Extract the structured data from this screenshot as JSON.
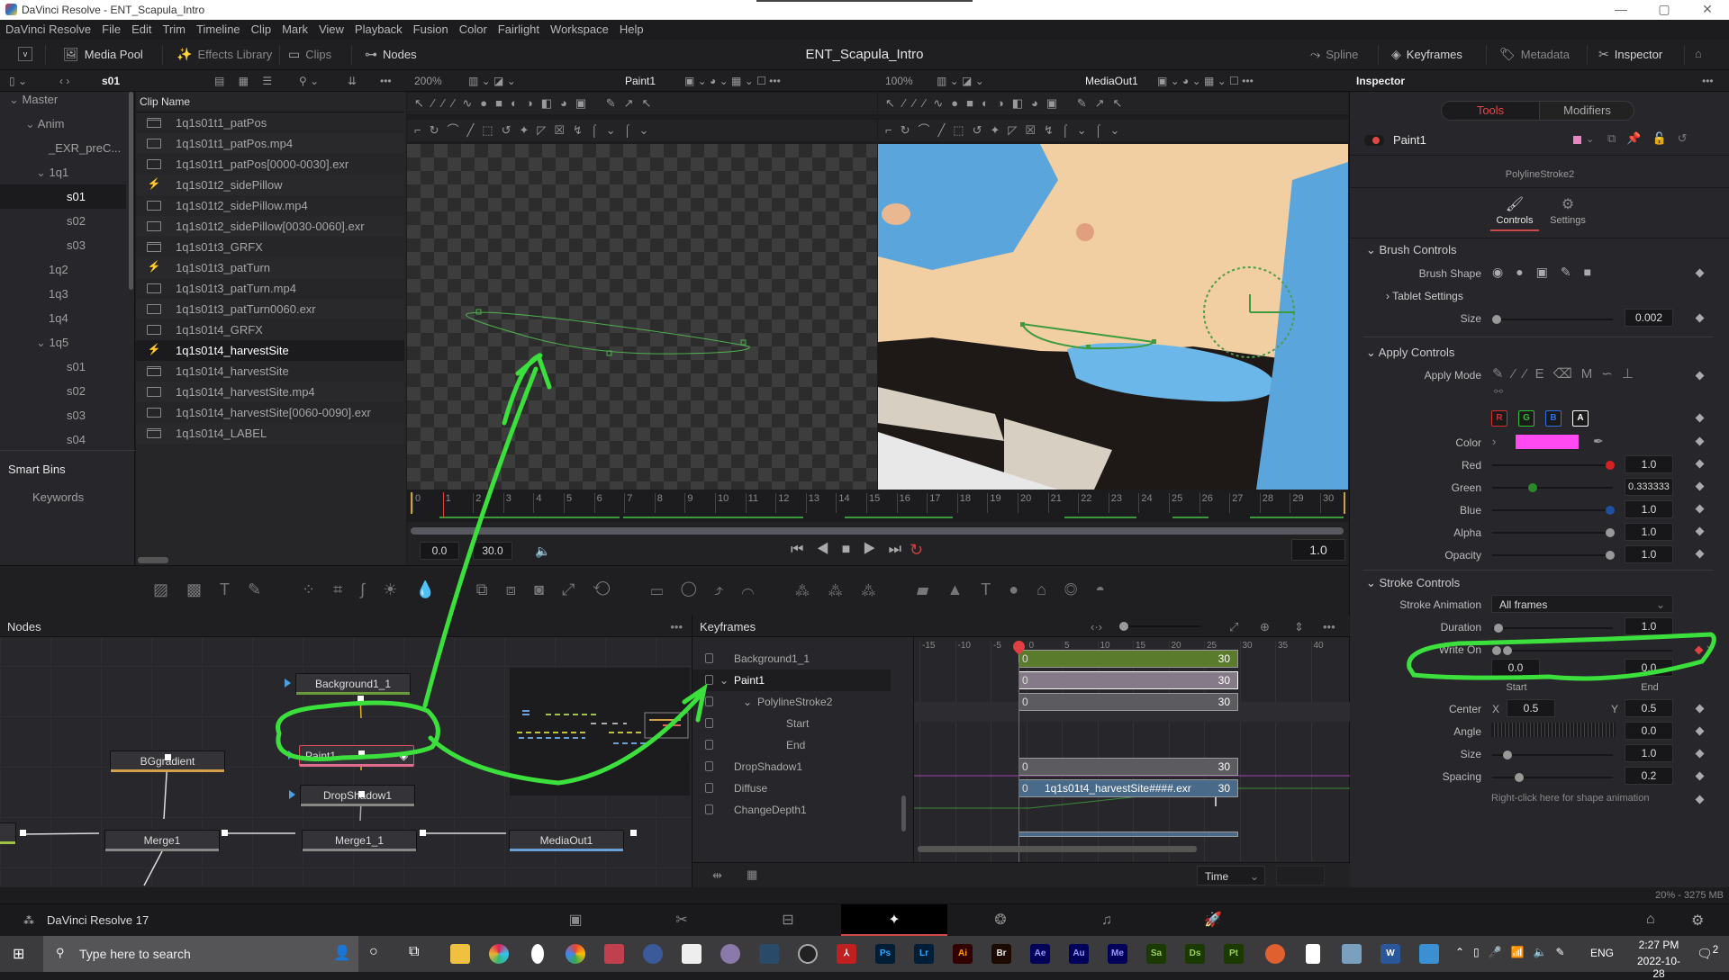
{
  "window": {
    "title": "DaVinci Resolve - ENT_Scapula_Intro",
    "controls": [
      "—",
      "▢",
      "✕"
    ]
  },
  "menu": [
    "DaVinci Resolve",
    "File",
    "Edit",
    "Trim",
    "Timeline",
    "Clip",
    "Mark",
    "View",
    "Playback",
    "Fusion",
    "Color",
    "Fairlight",
    "Workspace",
    "Help"
  ],
  "toolbar": {
    "media_pool": "Media Pool",
    "effects_library": "Effects Library",
    "clips": "Clips",
    "nodes": "Nodes",
    "project_title": "ENT_Scapula_Intro",
    "spline": "Spline",
    "keyframes": "Keyframes",
    "metadata": "Metadata",
    "inspector": "Inspector"
  },
  "subbar": {
    "current_bin": "s01",
    "viewer1_zoom": "200%",
    "viewer1_name": "Paint1",
    "viewer2_zoom": "100%",
    "viewer2_name": "MediaOut1",
    "inspector_title": "Inspector"
  },
  "bins": {
    "items": [
      {
        "label": "Master",
        "indent": 0,
        "expanded": true
      },
      {
        "label": "Anim",
        "indent": 1,
        "expanded": true
      },
      {
        "label": "_EXR_preC...",
        "indent": 2
      },
      {
        "label": "1q1",
        "indent": 2,
        "expanded": true
      },
      {
        "label": "s01",
        "indent": 3,
        "selected": true
      },
      {
        "label": "s02",
        "indent": 3
      },
      {
        "label": "s03",
        "indent": 3
      },
      {
        "label": "1q2",
        "indent": 2
      },
      {
        "label": "1q3",
        "indent": 2
      },
      {
        "label": "1q4",
        "indent": 2
      },
      {
        "label": "1q5",
        "indent": 2,
        "expanded": true
      },
      {
        "label": "s01",
        "indent": 3
      },
      {
        "label": "s02",
        "indent": 3
      },
      {
        "label": "s03",
        "indent": 3
      },
      {
        "label": "s04",
        "indent": 3
      }
    ],
    "smart_bins": "Smart Bins",
    "keywords": "Keywords"
  },
  "clips": {
    "header": "Clip Name",
    "items": [
      {
        "name": "1q1s01t1_patPos",
        "icon": "timeline"
      },
      {
        "name": "1q1s01t1_patPos.mp4",
        "icon": "video"
      },
      {
        "name": "1q1s01t1_patPos[0000-0030].exr",
        "icon": "video"
      },
      {
        "name": "1q1s01t2_sidePillow",
        "icon": "fusion"
      },
      {
        "name": "1q1s01t2_sidePillow.mp4",
        "icon": "video"
      },
      {
        "name": "1q1s01t2_sidePillow[0030-0060].exr",
        "icon": "video"
      },
      {
        "name": "1q1s01t3_GRFX",
        "icon": "timeline"
      },
      {
        "name": "1q1s01t3_patTurn",
        "icon": "fusion"
      },
      {
        "name": "1q1s01t3_patTurn.mp4",
        "icon": "video"
      },
      {
        "name": "1q1s01t3_patTurn0060.exr",
        "icon": "video"
      },
      {
        "name": "1q1s01t4_GRFX",
        "icon": "video"
      },
      {
        "name": "1q1s01t4_harvestSite",
        "icon": "fusion",
        "selected": true
      },
      {
        "name": "1q1s01t4_harvestSite",
        "icon": "timeline"
      },
      {
        "name": "1q1s01t4_harvestSite.mp4",
        "icon": "video"
      },
      {
        "name": "1q1s01t4_harvestSite[0060-0090].exr",
        "icon": "video"
      },
      {
        "name": "1q1s01t4_LABEL",
        "icon": "timeline"
      }
    ]
  },
  "ruler": {
    "ticks": [
      "0",
      "1",
      "2",
      "3",
      "4",
      "5",
      "6",
      "7",
      "8",
      "9",
      "10",
      "11",
      "12",
      "13",
      "14",
      "15",
      "16",
      "17",
      "18",
      "19",
      "20",
      "21",
      "22",
      "23",
      "24",
      "25",
      "26",
      "27",
      "28",
      "29",
      "30"
    ]
  },
  "transport": {
    "start": "0.0",
    "end": "30.0",
    "current": "1.0"
  },
  "inspector": {
    "tabs": [
      "Tools",
      "Modifiers"
    ],
    "active_tab": "Tools",
    "node_name": "Paint1",
    "tool_color": "#e884c0",
    "stroke_name": "PolylineStroke2",
    "subtabs": [
      "Controls",
      "Settings"
    ],
    "brush_controls": {
      "title": "Brush Controls",
      "brush_shape": "Brush Shape",
      "tablet_settings": "Tablet Settings",
      "size_label": "Size",
      "size": "0.002"
    },
    "apply_controls": {
      "title": "Apply Controls",
      "apply_mode": "Apply Mode",
      "channels": [
        "R",
        "G",
        "B",
        "A"
      ],
      "color_label": "Color",
      "color": "#ff4af2",
      "red_label": "Red",
      "red": "1.0",
      "green_label": "Green",
      "green": "0.333333",
      "blue_label": "Blue",
      "blue": "1.0",
      "alpha_label": "Alpha",
      "alpha": "1.0",
      "opacity_label": "Opacity",
      "opacity": "1.0"
    },
    "stroke_controls": {
      "title": "Stroke Controls",
      "stroke_animation_label": "Stroke Animation",
      "stroke_animation": "All frames",
      "duration_label": "Duration",
      "duration": "1.0",
      "write_on_label": "Write On",
      "write_on_start": "0.0",
      "write_on_end": "0.0",
      "start_label": "Start",
      "end_label": "End",
      "center_label": "Center",
      "x_label": "X",
      "y_label": "Y",
      "center_x": "0.5",
      "center_y": "0.5",
      "angle_label": "Angle",
      "angle": "0.0",
      "size_label": "Size",
      "size": "1.0",
      "spacing_label": "Spacing",
      "spacing": "0.2",
      "hint": "Right-click here for shape animation"
    }
  },
  "nodes_panel": {
    "title": "Nodes",
    "nodes": [
      {
        "name": "Background1_1",
        "color": "#6a9a3a"
      },
      {
        "name": "Paint1",
        "color": "#e06b8a",
        "selected": true
      },
      {
        "name": "DropShadow1",
        "color": "#888"
      },
      {
        "name": "BGgradient",
        "color": "#d4a04a"
      },
      {
        "name": "Merge1",
        "color": "#888"
      },
      {
        "name": "Merge1_1",
        "color": "#888"
      },
      {
        "name": "MediaOut1",
        "color": "#6aa0d8"
      }
    ]
  },
  "keyframes_panel": {
    "title": "Keyframes",
    "axis": [
      "-15",
      "-10",
      "-5",
      "0",
      "5",
      "10",
      "15",
      "20",
      "25",
      "30",
      "35",
      "40"
    ],
    "playhead": 0,
    "rows": [
      {
        "name": "Background1_1",
        "start": "0",
        "end": "30",
        "color": "#5a7a2c"
      },
      {
        "name": "Paint1",
        "start": "0",
        "end": "30",
        "color": "#857a88",
        "expanded": true
      },
      {
        "name": "PolylineStroke2",
        "start": "0",
        "end": "30",
        "color": "#5c5c60",
        "expanded": true
      },
      {
        "name": "Start"
      },
      {
        "name": "End"
      },
      {
        "name": "DropShadow1",
        "start": "0",
        "end": "30",
        "color": "#5c5c60"
      },
      {
        "name": "Diffuse",
        "start": "0",
        "end": "30",
        "label": "1q1s01t4_harvestSite####.exr",
        "color": "#4a6a8a"
      },
      {
        "name": "ChangeDepth1"
      }
    ],
    "time_mode": "Time"
  },
  "status": {
    "memory": "20% - 3275 MB"
  },
  "pagebar": {
    "app_name": "DaVinci Resolve 17",
    "pages": [
      "media",
      "cut",
      "edit",
      "fusion",
      "color",
      "fairlight",
      "deliver"
    ],
    "active_page": "fusion"
  },
  "taskbar": {
    "search_placeholder": "Type here to search",
    "apps": [
      "Ps",
      "Lr",
      "Ai",
      "Br",
      "Ae",
      "Au",
      "Me",
      "Sa",
      "Ds",
      "Pt"
    ],
    "lang": "ENG",
    "time": "2:27 PM",
    "date": "2022-10-28",
    "notifications": "2"
  }
}
